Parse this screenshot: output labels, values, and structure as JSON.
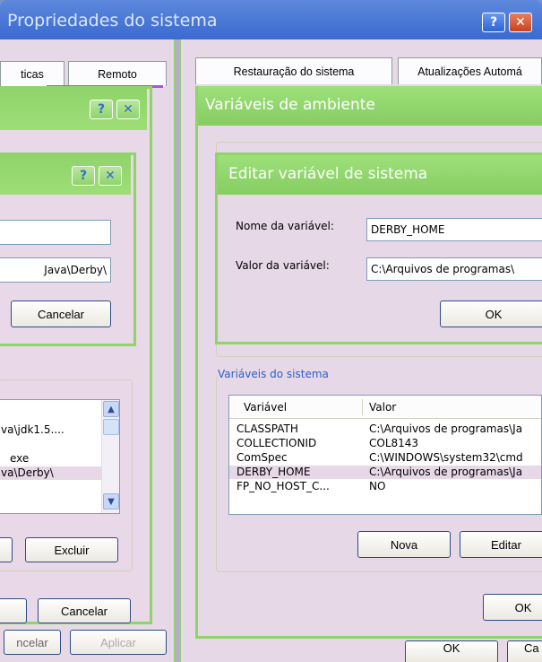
{
  "system_window": {
    "title": "Propriedades do sistema",
    "tabs_left": [
      "ticas",
      "Remoto"
    ],
    "tabs_right": [
      "Restauração do sistema",
      "Atualizações Automá"
    ],
    "bottom_buttons": [
      "ncelar",
      "Aplicar"
    ]
  },
  "back_dialog": {
    "list_rows": [
      "va\\jdk1.5....",
      "",
      "exe",
      "va\\Derby\\"
    ],
    "excluir": "Excluir",
    "cancelar": "Cancelar"
  },
  "mid_dialog": {
    "field1": "",
    "field2": "Java\\Derby\\",
    "cancelar": "Cancelar"
  },
  "env_window": {
    "title": "Variáveis de ambiente",
    "group_label": "Variáveis do sistema",
    "columns": [
      "Variável",
      "Valor"
    ],
    "rows": [
      {
        "name": "CLASSPATH",
        "value": "C:\\Arquivos de programas\\Ja"
      },
      {
        "name": "COLLECTIONID",
        "value": "COL8143"
      },
      {
        "name": "ComSpec",
        "value": "C:\\WINDOWS\\system32\\cmd"
      },
      {
        "name": "DERBY_HOME",
        "value": "C:\\Arquivos de programas\\Ja"
      },
      {
        "name": "FP_NO_HOST_C...",
        "value": "NO"
      }
    ],
    "nova": "Nova",
    "editar": "Editar",
    "ok": "OK",
    "bottom_ok": "OK",
    "bottom_ca": "Ca"
  },
  "edit_dialog": {
    "title": "Editar variável de sistema",
    "name_label": "Nome da variável:",
    "name_value": "DERBY_HOME",
    "value_label": "Valor da variável:",
    "value_value": "C:\\Arquivos de programas\\",
    "ok": "OK"
  },
  "colors": {
    "accent_green": "#8fd46a",
    "title_blue": "#3a6ad0",
    "pane": "#e6d8e6",
    "selection": "#e7d8e8"
  }
}
